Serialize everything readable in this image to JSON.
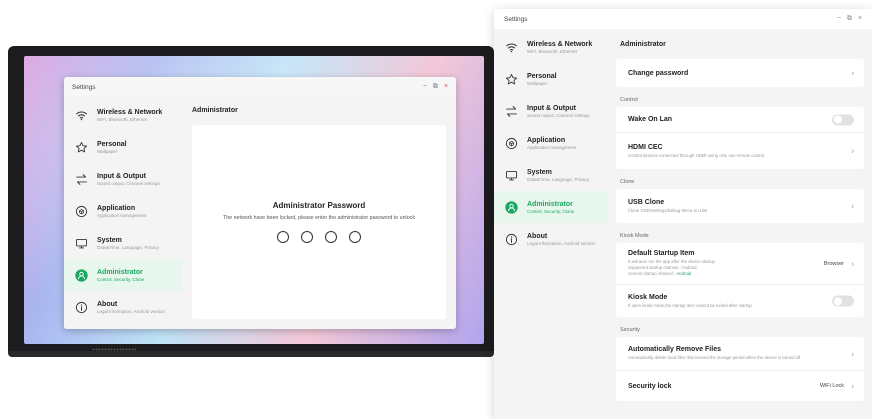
{
  "colors": {
    "accent": "#1aa860",
    "active_bg": "#e8f7ee",
    "sidebar_bg": "#f4f4f4",
    "close": "#e25050"
  },
  "window_controls": {
    "minimize": "−",
    "restore": "⧉",
    "close": "×"
  },
  "sidebar": {
    "items": [
      {
        "icon": "wifi-icon",
        "label": "Wireless & Network",
        "sub": "WiFi,  Bluetooth,  Ethernet"
      },
      {
        "icon": "star-icon",
        "label": "Personal",
        "sub": "Wallpaper"
      },
      {
        "icon": "swap-arrows-icon",
        "label": "Input & Output",
        "sub": "Sound output,  Channel settings"
      },
      {
        "icon": "app-box-icon",
        "label": "Application",
        "sub": "Application management"
      },
      {
        "icon": "monitor-icon",
        "label": "System",
        "sub": "Date&Time,  Language,  Privacy"
      },
      {
        "icon": "user-icon",
        "label": "Administrator",
        "sub": "Control,  Security,  Clone"
      },
      {
        "icon": "info-icon",
        "label": "About",
        "sub": "Legal information,  Android version"
      }
    ]
  },
  "small_window": {
    "title": "Settings",
    "header": "Administrator",
    "password_title": "Administrator Password",
    "password_sub": "The network have been locked, please enter the administrator password to unlock",
    "digits": 4
  },
  "large_window": {
    "title": "Settings",
    "header": "Administrator",
    "change_password": "Change password",
    "control": {
      "section": "Control",
      "wake_on_lan": "Wake On Lan",
      "hdmi_cec": "HDMI CEC",
      "hdmi_cec_desc": "Control devices connected through HDMI using only one remote control"
    },
    "clone": {
      "section": "Clone",
      "usb_clone": "USB Clone",
      "usb_clone_desc": "Clone OSD/Settings/Debug Menu to USB"
    },
    "kiosk": {
      "section": "Kiosk Mode",
      "startup_item": "Default Startup Item",
      "startup_desc1": "It will auto run the app after the device startup",
      "startup_desc2": "Supported startup channel : Android",
      "startup_desc3_prefix": "Current startup channel : ",
      "startup_desc3_value": "Android",
      "startup_value": "Browser",
      "kiosk_mode": "Kiosk Mode",
      "kiosk_mode_desc": "If open kiosk mode,the startup item cannot be exited after startup"
    },
    "security": {
      "section": "Security",
      "auto_remove": "Automatically Remove Files",
      "auto_remove_desc": "Automatically delete local files that exceed the storage period when the device is turned off",
      "security_lock": "Security lock",
      "security_lock_value": "WiFi Lock"
    }
  }
}
